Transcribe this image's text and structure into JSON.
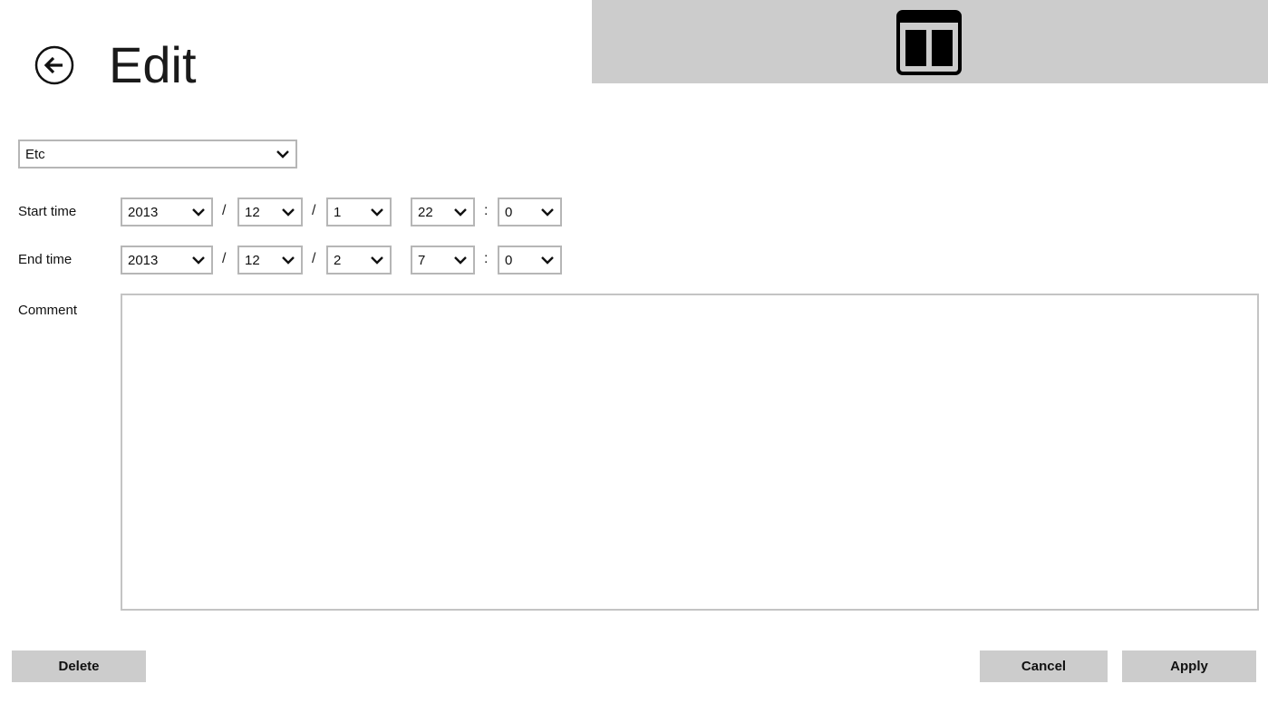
{
  "header": {
    "title": "Edit",
    "back_icon": "back-arrow-circle-icon",
    "layout_icon": "two-column-layout-icon",
    "banner_color": "#cccccc"
  },
  "category": {
    "selected": "Etc"
  },
  "start_time": {
    "label": "Start time",
    "year": "2013",
    "month": "12",
    "day": "1",
    "hour": "22",
    "minute": "0"
  },
  "end_time": {
    "label": "End time",
    "year": "2013",
    "month": "12",
    "day": "2",
    "hour": "7",
    "minute": "0"
  },
  "separators": {
    "date": "/",
    "time": ":"
  },
  "comment": {
    "label": "Comment",
    "value": ""
  },
  "actions": {
    "delete_label": "Delete",
    "cancel_label": "Cancel",
    "apply_label": "Apply",
    "button_color": "#cccccc"
  }
}
